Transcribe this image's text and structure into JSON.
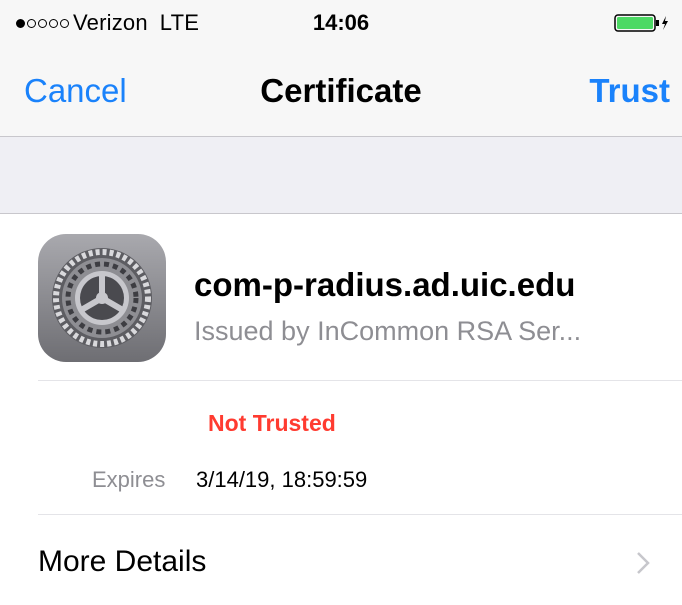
{
  "status_bar": {
    "signal": "●○○○○",
    "carrier": "Verizon",
    "network": "LTE",
    "time": "14:06",
    "battery_color": "#4cd964"
  },
  "nav": {
    "cancel_label": "Cancel",
    "title": "Certificate",
    "trust_label": "Trust",
    "accent_color": "#1a82fb"
  },
  "certificate": {
    "icon": "settings-gear-icon",
    "name": "com-p-radius.ad.uic.edu",
    "issuer": "Issued by InCommon RSA Ser...",
    "status": "Not Trusted",
    "status_color": "#ff3b30",
    "expires_label": "Expires",
    "expires_value": "3/14/19, 18:59:59"
  },
  "more_details": {
    "label": "More Details",
    "icon": "chevron-right-icon"
  }
}
